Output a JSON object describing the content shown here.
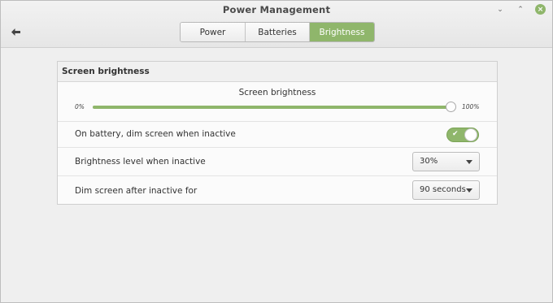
{
  "window": {
    "title": "Power Management",
    "controls": [
      "minimize-icon",
      "restore-icon",
      "close-icon"
    ]
  },
  "toolbar": {
    "back_icon": "back-arrow-icon"
  },
  "tabs": [
    {
      "label": "Power",
      "active": false
    },
    {
      "label": "Batteries",
      "active": false
    },
    {
      "label": "Brightness",
      "active": true
    }
  ],
  "accent_color": "#8fb66b",
  "section": {
    "title": "Screen brightness",
    "slider": {
      "label": "Screen brightness",
      "min_label": "0%",
      "max_label": "100%",
      "value_fraction": 0.99
    },
    "dim_on_battery": {
      "label": "On battery, dim screen when inactive",
      "enabled": true,
      "icon": "check-icon"
    },
    "brightness_when_inactive": {
      "label": "Brightness level when inactive",
      "selected": "30%"
    },
    "dim_after": {
      "label": "Dim screen after inactive for",
      "selected": "90 seconds"
    }
  }
}
